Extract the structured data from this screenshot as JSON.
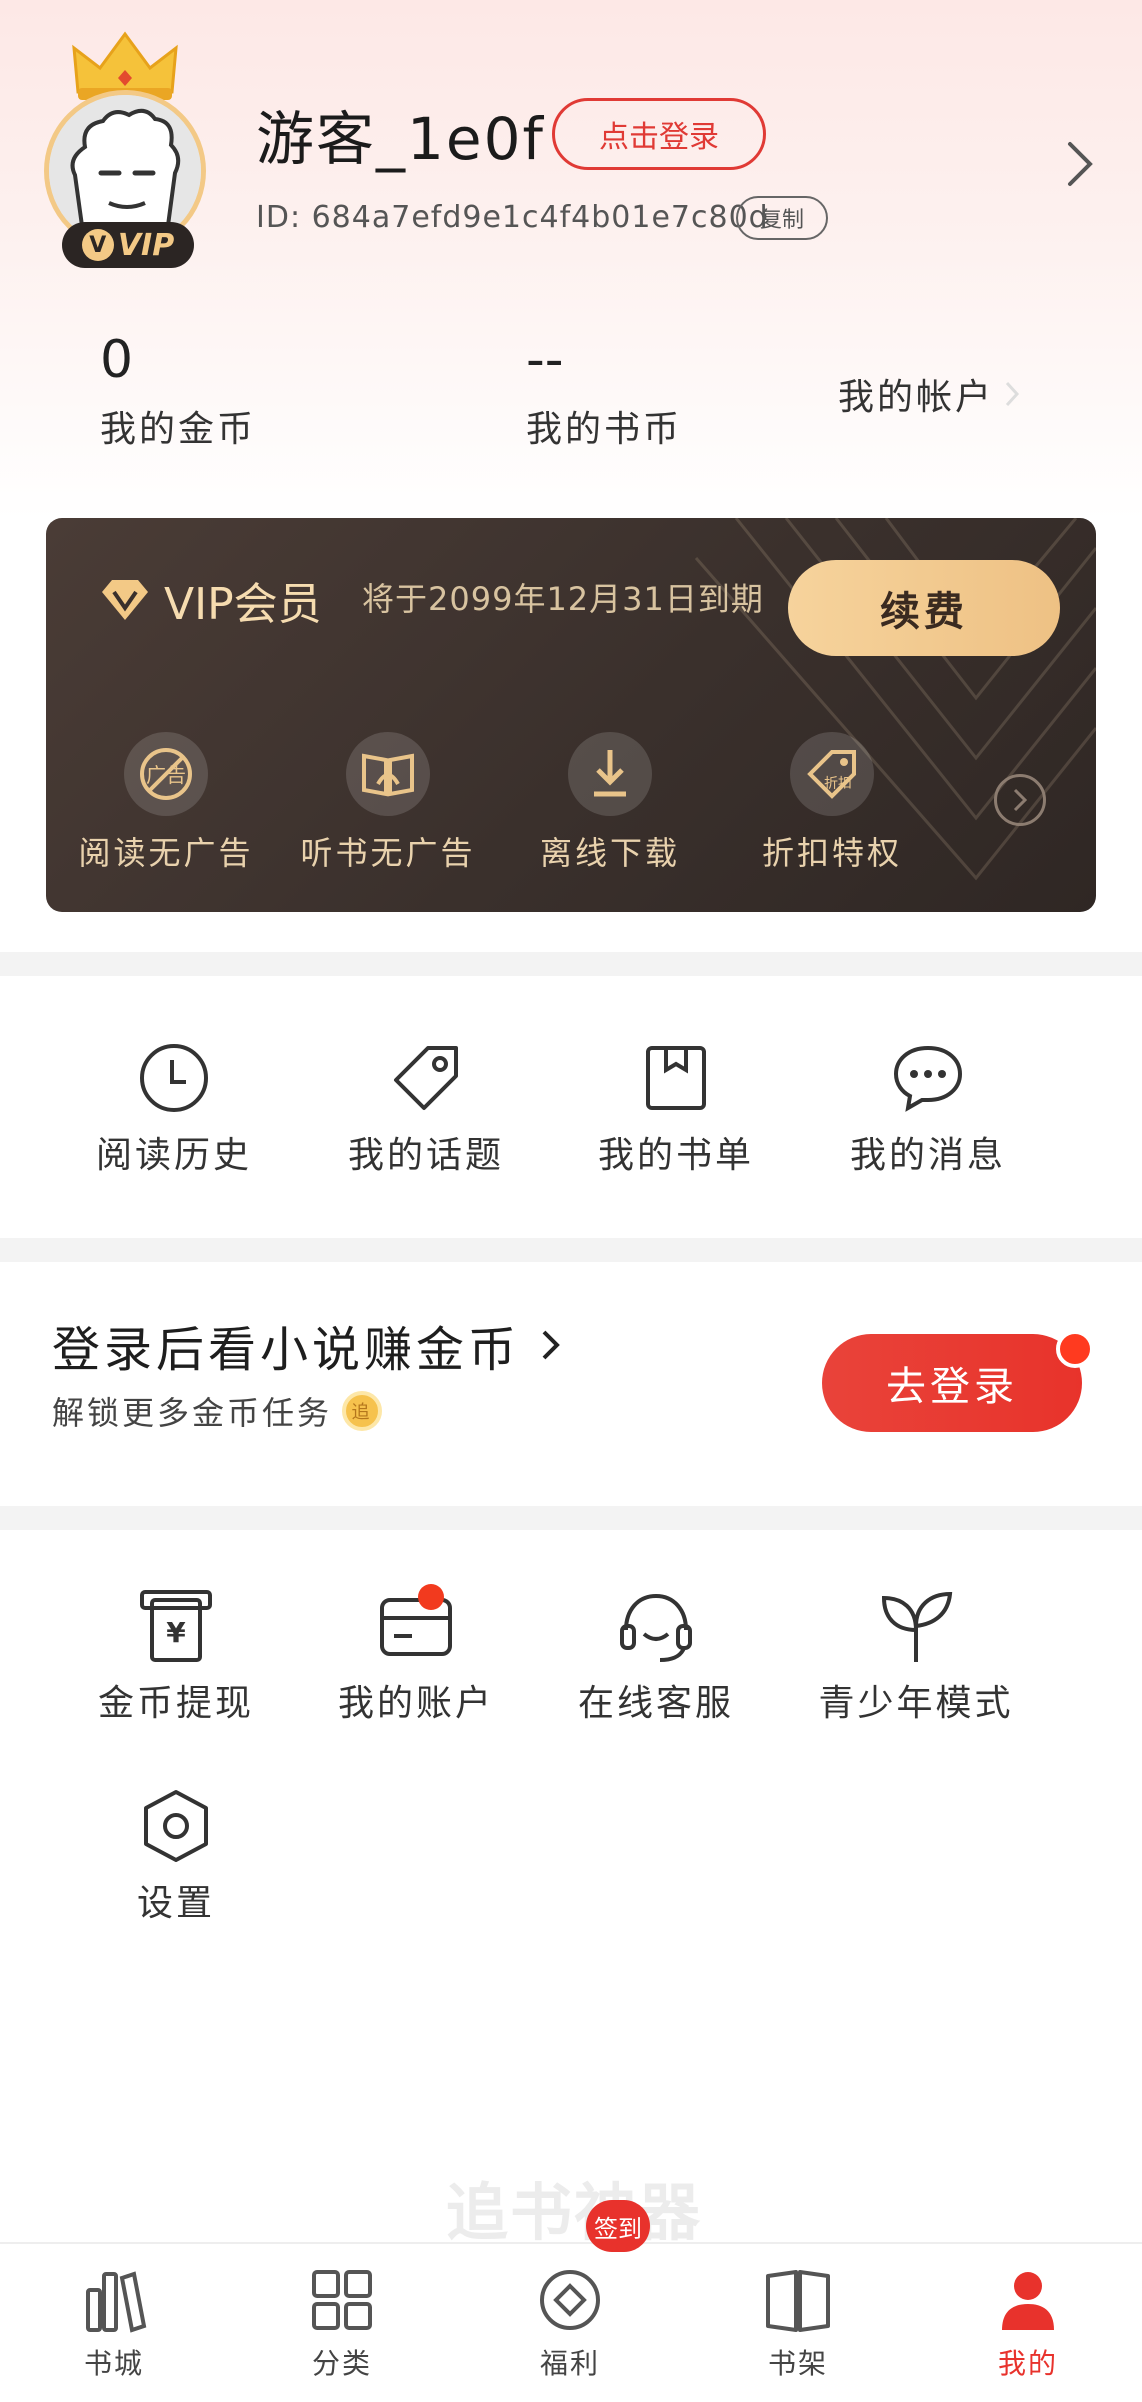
{
  "profile": {
    "username": "游客_1e0f",
    "login_label": "点击登录",
    "user_id": "ID: 684a7efd9e1c4f4b01e7c80d",
    "copy_label": "复制",
    "avatar_badge": "VIP"
  },
  "stats": {
    "coins_value": "0",
    "coins_label": "我的金币",
    "book_coins_value": "--",
    "book_coins_label": "我的书币",
    "account_label": "我的帐户"
  },
  "vip": {
    "title": "VIP会员",
    "expire_text": "将于2099年12月31日到期",
    "renew_label": "续费",
    "perks": [
      {
        "label": "阅读无广告",
        "icon": "no-ad-icon"
      },
      {
        "label": "听书无广告",
        "icon": "audiobook-icon"
      },
      {
        "label": "离线下载",
        "icon": "download-icon"
      },
      {
        "label": "折扣特权",
        "icon": "discount-tag-icon"
      }
    ]
  },
  "quick_links": [
    {
      "label": "阅读历史",
      "icon": "clock-icon"
    },
    {
      "label": "我的话题",
      "icon": "tag-icon"
    },
    {
      "label": "我的书单",
      "icon": "booklist-icon"
    },
    {
      "label": "我的消息",
      "icon": "chat-bubble-icon"
    }
  ],
  "promo": {
    "title": "登录后看小说赚金币",
    "subtitle": "解锁更多金币任务",
    "coin_glyph": "追",
    "button_label": "去登录"
  },
  "services": [
    {
      "label": "金币提现",
      "icon": "withdraw-icon"
    },
    {
      "label": "我的账户",
      "icon": "wallet-card-icon"
    },
    {
      "label": "在线客服",
      "icon": "headset-icon"
    },
    {
      "label": "青少年模式",
      "icon": "sprout-icon"
    },
    {
      "label": "设置",
      "icon": "settings-hex-icon"
    }
  ],
  "watermark": "追书神器",
  "tabbar": {
    "items": [
      {
        "label": "书城",
        "icon": "bookstore-icon"
      },
      {
        "label": "分类",
        "icon": "grid-icon"
      },
      {
        "label": "福利",
        "icon": "coin-target-icon"
      },
      {
        "label": "书架",
        "icon": "open-book-icon"
      },
      {
        "label": "我的",
        "icon": "person-icon"
      }
    ],
    "sign_badge": "签到",
    "active_index": 4
  },
  "colors": {
    "accent": "#e8322c",
    "vip_gold": "#f3c986",
    "vip_card_bg": "#3a302c"
  }
}
